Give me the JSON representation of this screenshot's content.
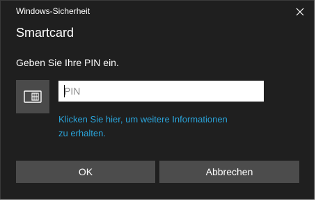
{
  "window": {
    "title": "Windows-Sicherheit",
    "close_icon": "close-icon"
  },
  "dialog": {
    "heading": "Smartcard",
    "prompt": "Geben Sie Ihre PIN ein.",
    "card_icon": "smartcard-icon",
    "pin": {
      "value": "",
      "placeholder": "PIN"
    },
    "info_link_line1": "Klicken Sie hier, um weitere Informationen",
    "info_link_line2": "zu erhalten."
  },
  "buttons": {
    "ok_label": "OK",
    "cancel_label": "Abbrechen"
  },
  "colors": {
    "background": "#1f1f1f",
    "button": "#4c4c4c",
    "tile": "#4a4a4a",
    "link": "#2aa3d9",
    "text": "#ffffff"
  }
}
